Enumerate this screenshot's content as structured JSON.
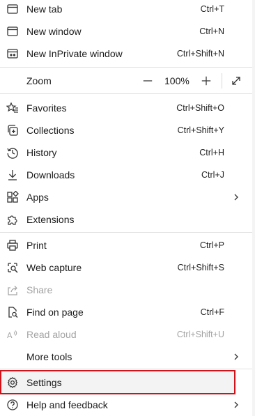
{
  "menu": {
    "new_tab": {
      "label": "New tab",
      "shortcut": "Ctrl+T",
      "icon": "new-tab-icon"
    },
    "new_window": {
      "label": "New window",
      "shortcut": "Ctrl+N",
      "icon": "window-icon"
    },
    "new_inprivate": {
      "label": "New InPrivate window",
      "shortcut": "Ctrl+Shift+N",
      "icon": "inprivate-icon"
    },
    "zoom": {
      "label": "Zoom",
      "value": "100%",
      "minus": "—",
      "plus": "+"
    },
    "favorites": {
      "label": "Favorites",
      "shortcut": "Ctrl+Shift+O",
      "icon": "favorites-icon"
    },
    "collections": {
      "label": "Collections",
      "shortcut": "Ctrl+Shift+Y",
      "icon": "collections-icon"
    },
    "history": {
      "label": "History",
      "shortcut": "Ctrl+H",
      "icon": "history-icon"
    },
    "downloads": {
      "label": "Downloads",
      "shortcut": "Ctrl+J",
      "icon": "download-icon"
    },
    "apps": {
      "label": "Apps",
      "icon": "apps-icon"
    },
    "extensions": {
      "label": "Extensions",
      "icon": "extensions-icon"
    },
    "print": {
      "label": "Print",
      "shortcut": "Ctrl+P",
      "icon": "print-icon"
    },
    "web_capture": {
      "label": "Web capture",
      "shortcut": "Ctrl+Shift+S",
      "icon": "web-capture-icon"
    },
    "share": {
      "label": "Share",
      "icon": "share-icon",
      "disabled": true
    },
    "find_on_page": {
      "label": "Find on page",
      "shortcut": "Ctrl+F",
      "icon": "find-icon"
    },
    "read_aloud": {
      "label": "Read aloud",
      "shortcut": "Ctrl+Shift+U",
      "icon": "read-aloud-icon",
      "disabled": true
    },
    "more_tools": {
      "label": "More tools"
    },
    "settings": {
      "label": "Settings",
      "icon": "gear-icon",
      "highlighted": true
    },
    "help_feedback": {
      "label": "Help and feedback",
      "icon": "help-icon"
    }
  },
  "colors": {
    "highlight_border": "#d0121b",
    "text": "#1b1b1b",
    "disabled_text": "#a3a3a3",
    "separator": "#e1e1e1"
  }
}
